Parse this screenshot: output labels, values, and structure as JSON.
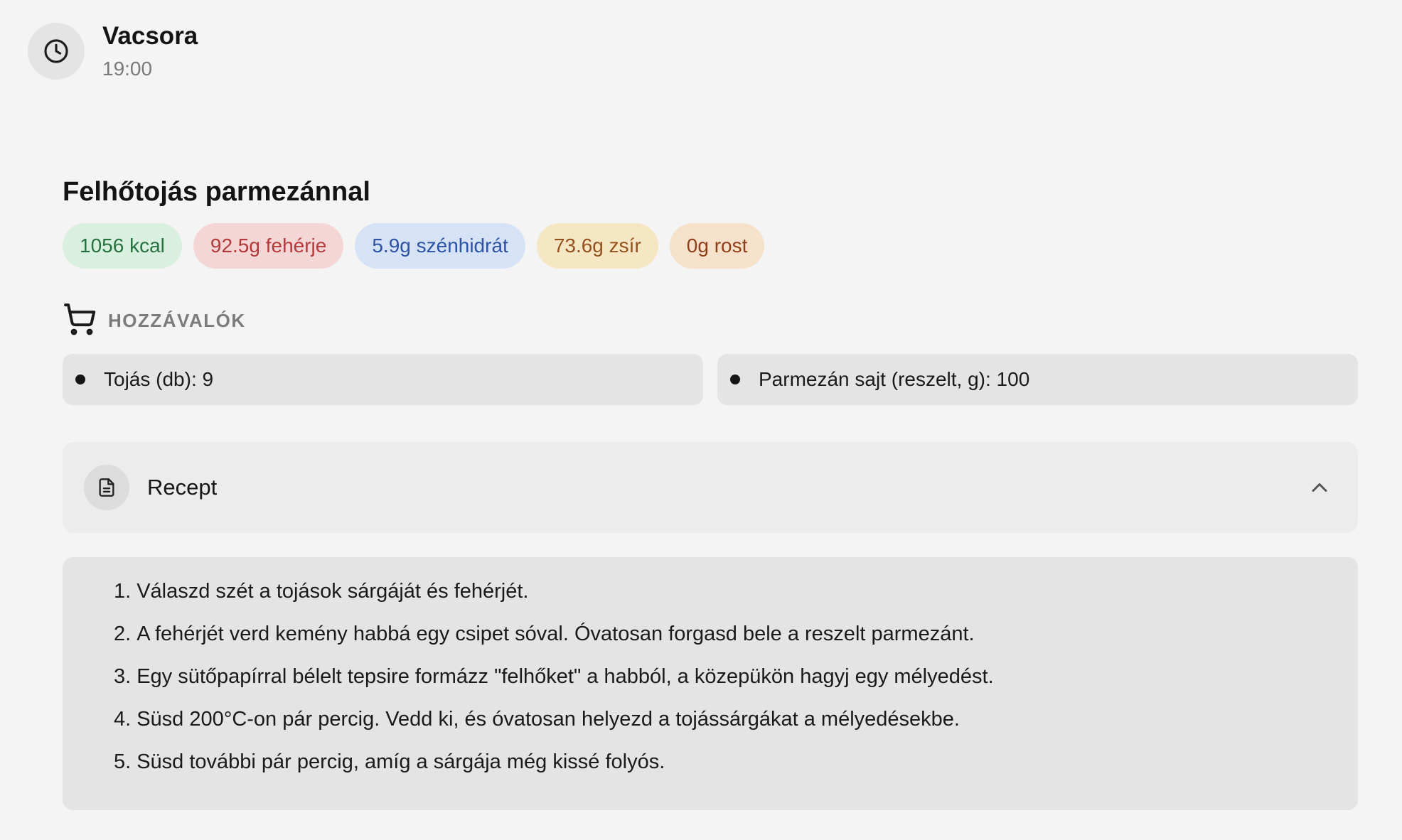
{
  "meal": {
    "title": "Vacsora",
    "time": "19:00",
    "icon": "clock-icon"
  },
  "recipe": {
    "title": "Felhőtojás parmezánnal",
    "nutrition": [
      {
        "label": "1056 kcal",
        "color_bg": "#d9efdf",
        "color_fg": "#27713f"
      },
      {
        "label": "92.5g fehérje",
        "color_bg": "#f5d6d6",
        "color_fg": "#b33a3a"
      },
      {
        "label": "5.9g szénhidrát",
        "color_bg": "#d6e3f7",
        "color_fg": "#2c52a6"
      },
      {
        "label": "73.6g zsír",
        "color_bg": "#f6e7c4",
        "color_fg": "#93511d"
      },
      {
        "label": "0g rost",
        "color_bg": "#f6e2cb",
        "color_fg": "#8e3e1a"
      }
    ],
    "ingredients_section": {
      "label": "HOZZÁVALÓK",
      "icon": "shopping-cart-icon"
    },
    "ingredients": [
      "Tojás (db): 9",
      "Parmezán sajt (reszelt, g): 100"
    ],
    "accordion": {
      "title": "Recept",
      "icon": "document-icon",
      "toggle_icon": "chevron-up-icon",
      "expanded": true
    },
    "steps": [
      {
        "num": "1.",
        "text": "Válaszd szét a tojások sárgáját és fehérjét."
      },
      {
        "num": "2.",
        "text": "A fehérjét verd kemény habbá egy csipet sóval. Óvatosan forgasd bele a reszelt parmezánt."
      },
      {
        "num": "3.",
        "text": "Egy sütőpapírral bélelt tepsire formázz \"felhőket\" a habból, a közepükön hagyj egy mélyedést."
      },
      {
        "num": "4.",
        "text": "Süsd 200°C-on pár percig. Vedd ki, és óvatosan helyezd a tojássárgákat a mélyedésekbe."
      },
      {
        "num": "5.",
        "text": "Süsd további pár percig, amíg a sárgája még kissé folyós."
      }
    ]
  }
}
